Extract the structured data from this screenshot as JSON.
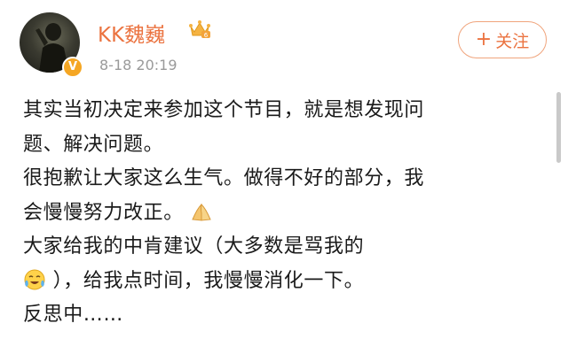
{
  "user": {
    "name": "KK魏巍",
    "time": "8-18 20:19",
    "verified_badge": "V",
    "crown_icon": "crown-icon"
  },
  "actions": {
    "follow_plus": "+",
    "follow_label": "关注"
  },
  "post": {
    "lines": [
      "其实当初决定来参加这个节目，就是想发现问",
      "题、解决问题。",
      "很抱歉让大家这么生气。做得不好的部分，我",
      "会慢慢努力改正。",
      "大家给我的中肯建议（大多数是骂我的",
      "），给我点时间，我慢慢消化一下。",
      "反思中……"
    ],
    "emoji_hands": "praying-hands-emoji",
    "emoji_cry": "laughing-crying-emoji"
  },
  "colors": {
    "accent": "#eb7340",
    "text": "#1a1a1a",
    "muted": "#9a9a9a",
    "badge": "#f5a623"
  }
}
